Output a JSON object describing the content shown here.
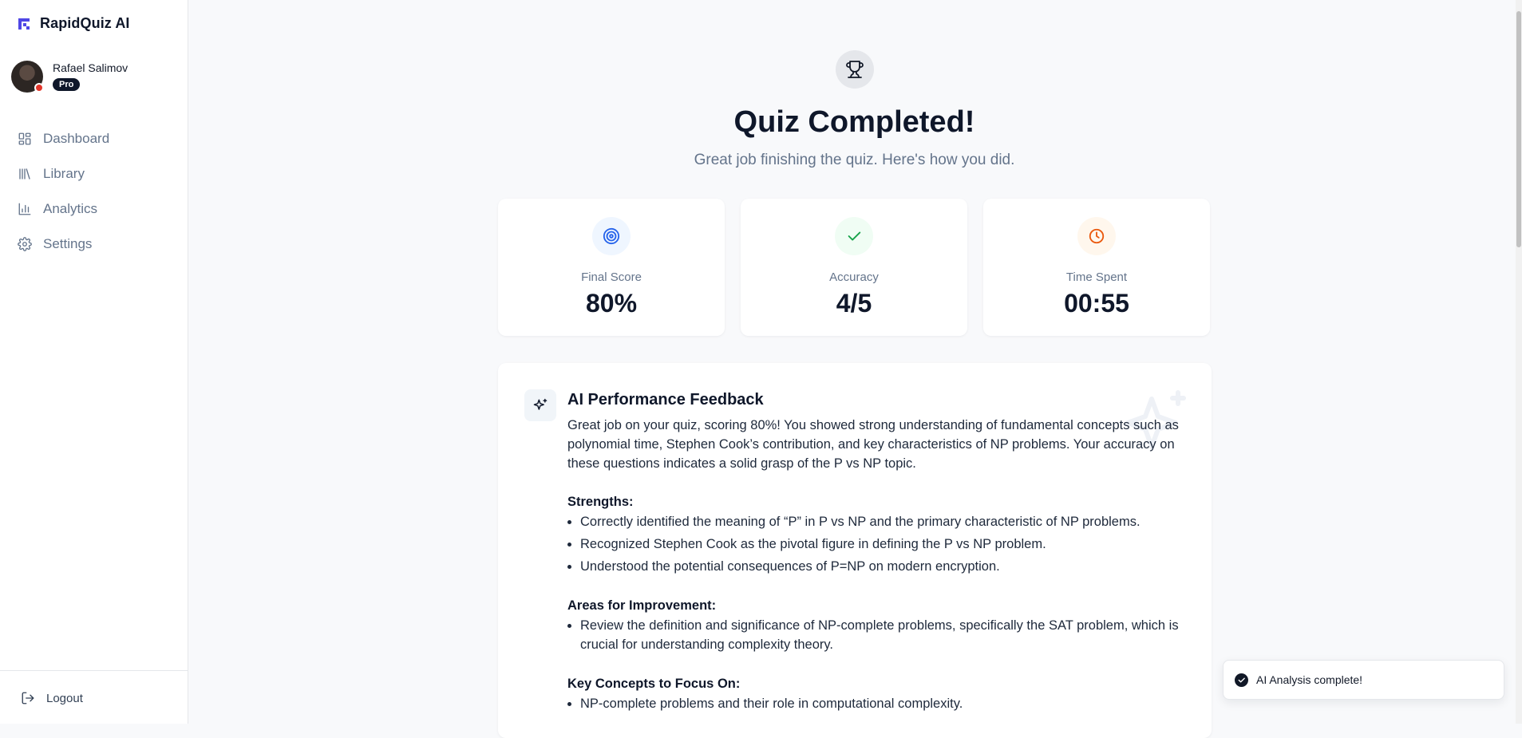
{
  "app": {
    "name": "RapidQuiz AI",
    "brand_color": "#4f46e5"
  },
  "user": {
    "name": "Rafael Salimov",
    "plan_badge": "Pro"
  },
  "sidebar": {
    "items": [
      {
        "label": "Dashboard",
        "icon": "layout-grid-icon"
      },
      {
        "label": "Library",
        "icon": "library-icon"
      },
      {
        "label": "Analytics",
        "icon": "bar-chart-icon"
      },
      {
        "label": "Settings",
        "icon": "gear-icon"
      }
    ],
    "logout_label": "Logout"
  },
  "result": {
    "title": "Quiz Completed!",
    "subtitle": "Great job finishing the quiz. Here's how you did.",
    "stats": [
      {
        "label": "Final Score",
        "value": "80%",
        "icon": "target-icon",
        "color": "#2563eb"
      },
      {
        "label": "Accuracy",
        "value": "4/5",
        "icon": "check-icon",
        "color": "#16a34a"
      },
      {
        "label": "Time Spent",
        "value": "00:55",
        "icon": "clock-icon",
        "color": "#ea580c"
      }
    ]
  },
  "feedback": {
    "title": "AI Performance Feedback",
    "intro": "Great job on your quiz, scoring 80%! You showed strong understanding of fundamental concepts such as polynomial time, Stephen Cook’s contribution, and key characteristics of NP problems. Your accuracy on these questions indicates a solid grasp of the P vs NP topic.",
    "sections": {
      "strengths": {
        "heading": "Strengths:",
        "items": [
          "Correctly identified the meaning of “P” in P vs NP and the primary characteristic of NP problems.",
          "Recognized Stephen Cook as the pivotal figure in defining the P vs NP problem.",
          "Understood the potential consequences of P=NP on modern encryption."
        ]
      },
      "improvement": {
        "heading": "Areas for Improvement:",
        "items": [
          "Review the definition and significance of NP-complete problems, specifically the SAT problem, which is crucial for understanding complexity theory."
        ]
      },
      "focus": {
        "heading": "Key Concepts to Focus On:",
        "items": [
          "NP-complete problems and their role in computational complexity."
        ]
      }
    }
  },
  "toast": {
    "message": "AI Analysis complete!"
  }
}
